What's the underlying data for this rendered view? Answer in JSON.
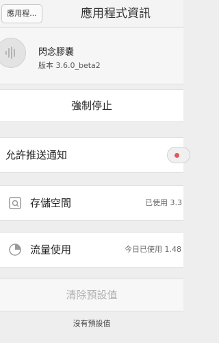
{
  "header": {
    "back_label": "應用程...",
    "title": "應用程式資訊"
  },
  "app": {
    "name": "閃念膠囊",
    "version": "版本 3.6.0_beta2",
    "icon": "voice-wave-icon"
  },
  "actions": {
    "force_stop": "強制停止",
    "clear_defaults": "清除預設值",
    "no_defaults": "沒有預設值"
  },
  "notifications": {
    "label": "允許推送通知",
    "enabled": false
  },
  "storage": {
    "label": "存儲空間",
    "value": "已使用 3.3",
    "icon": "sd-card-icon"
  },
  "data_usage": {
    "label": "流量使用",
    "value": "今日已使用 1.48",
    "icon": "pie-chart-icon"
  },
  "colors": {
    "toggle_dot": "#e05a5a",
    "disabled_text": "#b0b0b0"
  }
}
